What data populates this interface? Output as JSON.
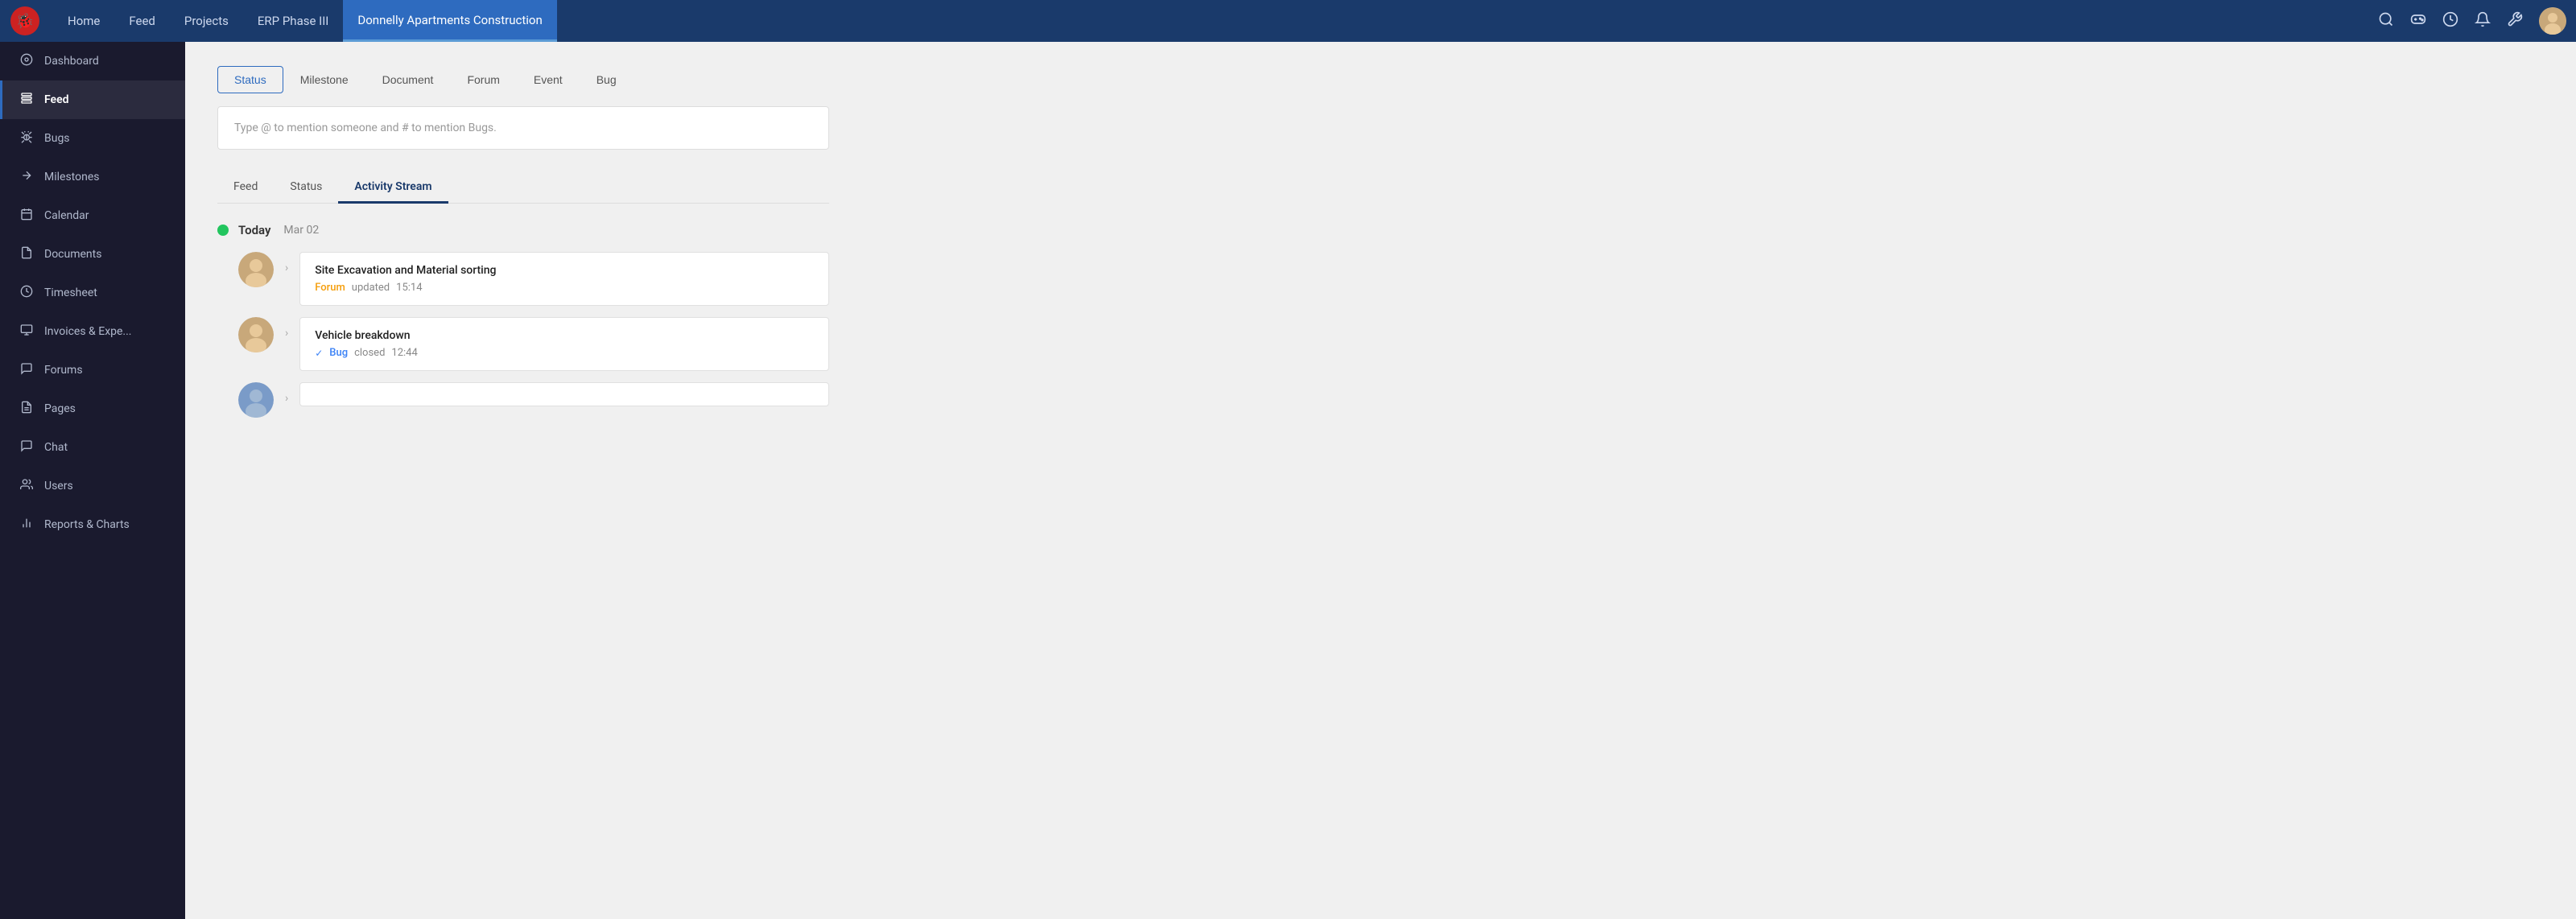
{
  "topNav": {
    "logo_alt": "App Logo",
    "items": [
      {
        "label": "Home",
        "active": false
      },
      {
        "label": "Feed",
        "active": false
      },
      {
        "label": "Projects",
        "active": false
      },
      {
        "label": "ERP Phase III",
        "active": false
      },
      {
        "label": "Donnelly Apartments Construction",
        "active": true
      }
    ],
    "icons": [
      {
        "name": "search-icon",
        "symbol": "🔍"
      },
      {
        "name": "gamepad-icon",
        "symbol": "🎮"
      },
      {
        "name": "clock-icon",
        "symbol": "🕐"
      },
      {
        "name": "bell-icon",
        "symbol": "🔔"
      },
      {
        "name": "settings-icon",
        "symbol": "⚙"
      }
    ]
  },
  "sidebar": {
    "items": [
      {
        "label": "Dashboard",
        "icon": "⊙",
        "active": false
      },
      {
        "label": "Feed",
        "icon": "≡",
        "active": true
      },
      {
        "label": "Bugs",
        "icon": "🐛",
        "active": false
      },
      {
        "label": "Milestones",
        "icon": "⇝",
        "active": false
      },
      {
        "label": "Calendar",
        "icon": "📅",
        "active": false
      },
      {
        "label": "Documents",
        "icon": "📄",
        "active": false
      },
      {
        "label": "Timesheet",
        "icon": "⏱",
        "active": false
      },
      {
        "label": "Invoices & Expe...",
        "icon": "📊",
        "active": false
      },
      {
        "label": "Forums",
        "icon": "📢",
        "active": false
      },
      {
        "label": "Pages",
        "icon": "📋",
        "active": false
      },
      {
        "label": "Chat",
        "icon": "💬",
        "active": false
      },
      {
        "label": "Users",
        "icon": "👥",
        "active": false
      },
      {
        "label": "Reports & Charts",
        "icon": "📈",
        "active": false
      }
    ]
  },
  "postTabs": {
    "tabs": [
      {
        "label": "Status",
        "active": true
      },
      {
        "label": "Milestone",
        "active": false
      },
      {
        "label": "Document",
        "active": false
      },
      {
        "label": "Forum",
        "active": false
      },
      {
        "label": "Event",
        "active": false
      },
      {
        "label": "Bug",
        "active": false
      }
    ],
    "placeholder": "Type @ to mention someone and # to mention Bugs."
  },
  "feedTabs": {
    "tabs": [
      {
        "label": "Feed",
        "active": false
      },
      {
        "label": "Status",
        "active": false
      },
      {
        "label": "Activity Stream",
        "active": true
      }
    ]
  },
  "activityStream": {
    "dateLabel": "Today",
    "dateSub": "Mar 02",
    "items": [
      {
        "title": "Site Excavation and Material sorting",
        "tagType": "forum",
        "tagLabel": "Forum",
        "action": "updated",
        "time": "15:14",
        "avatar_type": "female"
      },
      {
        "title": "Vehicle breakdown",
        "tagType": "bug",
        "tagLabel": "Bug",
        "action": "closed",
        "time": "12:44",
        "avatar_type": "female"
      },
      {
        "title": "",
        "tagType": "",
        "tagLabel": "",
        "action": "",
        "time": "",
        "avatar_type": "male"
      }
    ]
  }
}
